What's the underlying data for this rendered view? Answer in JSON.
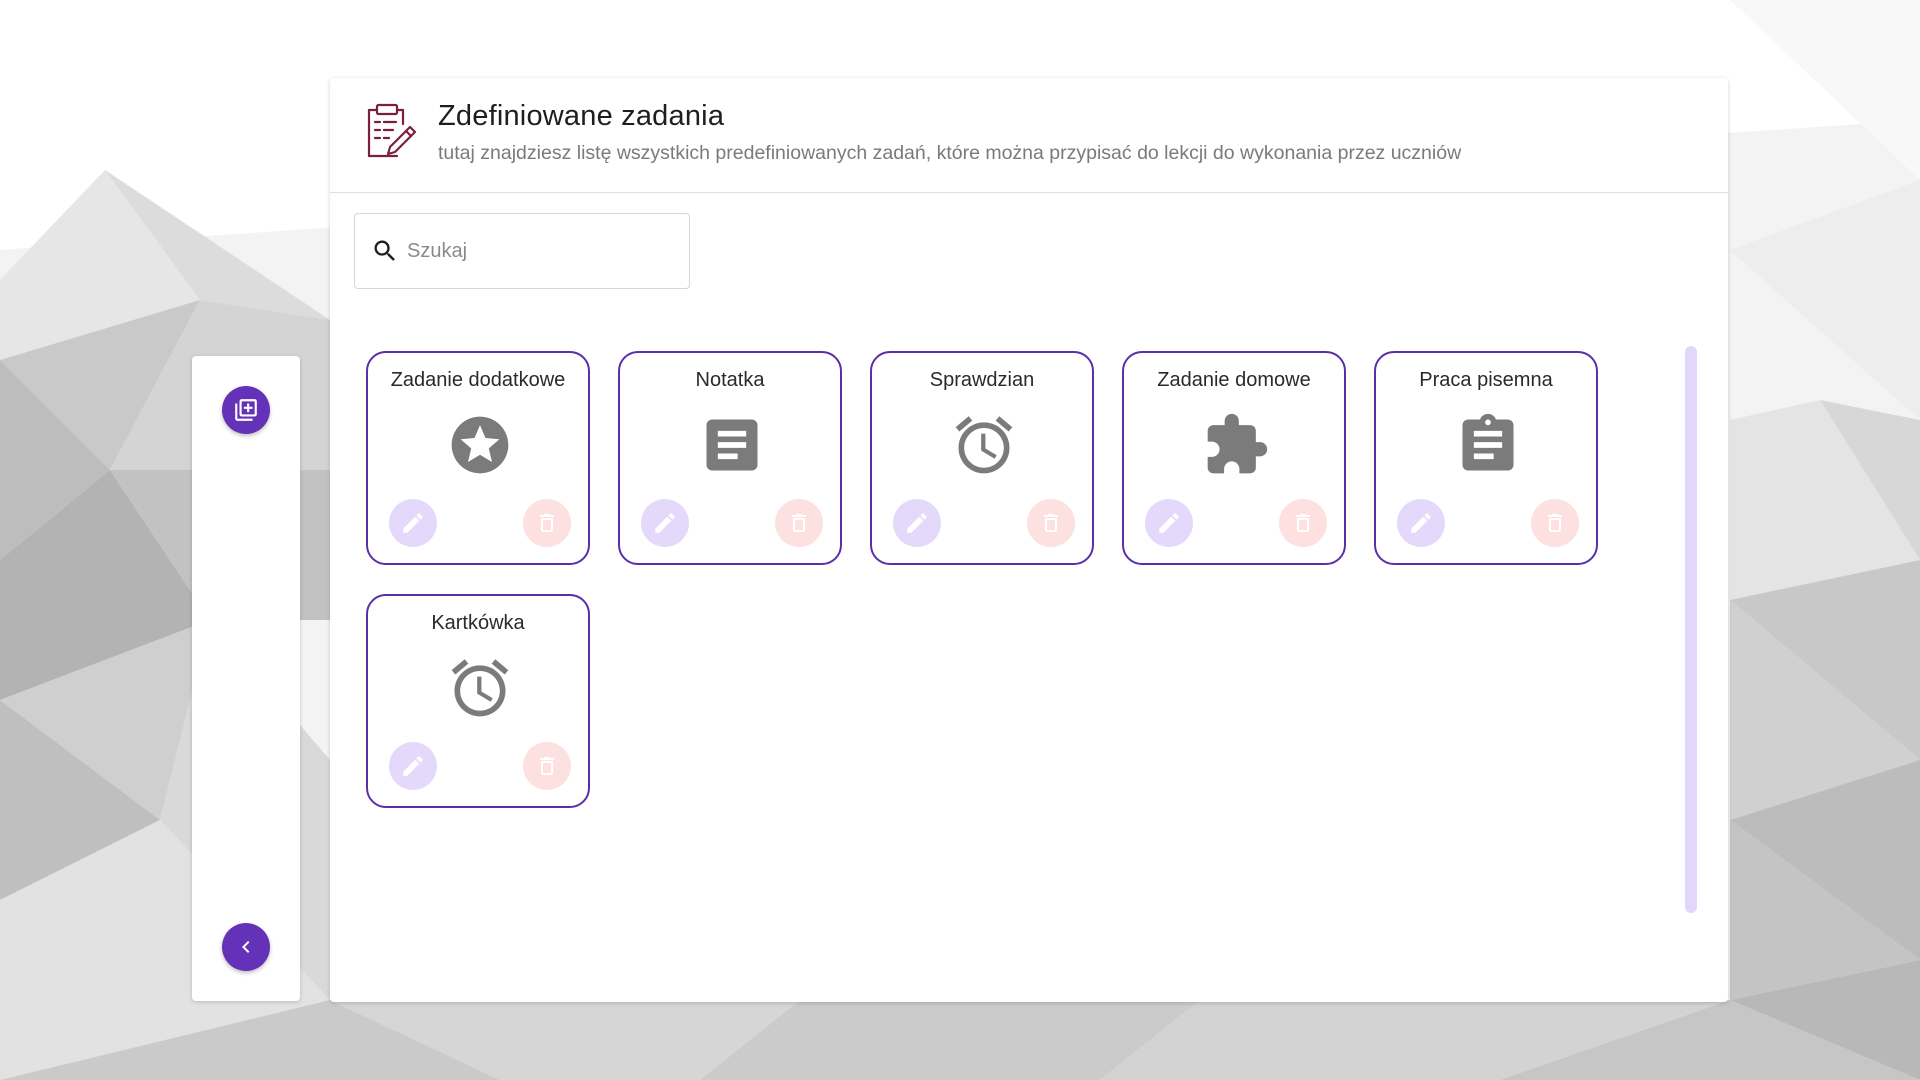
{
  "header": {
    "title": "Zdefiniowane zadania",
    "subtitle": "tutaj znajdziesz listę wszystkich predefiniowanych zadań, które można przypisać do lekcji do wykonania przez uczniów",
    "icon": "clipboard-pen-icon"
  },
  "search": {
    "placeholder": "Szukaj",
    "value": "",
    "icon": "search-icon"
  },
  "rail": {
    "add_icon": "add-library-icon",
    "collapse_icon": "chevron-left-icon"
  },
  "tasks": [
    {
      "name": "Zadanie dodatkowe",
      "icon": "star-circle-icon"
    },
    {
      "name": "Notatka",
      "icon": "note-icon"
    },
    {
      "name": "Sprawdzian",
      "icon": "alarm-clock-icon"
    },
    {
      "name": "Zadanie domowe",
      "icon": "puzzle-icon"
    },
    {
      "name": "Praca pisemna",
      "icon": "clipboard-text-icon"
    },
    {
      "name": "Kartkówka",
      "icon": "alarm-clock-icon"
    }
  ],
  "card_actions": {
    "edit_icon": "pencil-icon",
    "delete_icon": "trash-icon"
  },
  "colors": {
    "accent": "#6432b8",
    "card_border": "#5b2fa8",
    "edit_bg": "#e4d9fb",
    "delete_bg": "#fde0e0",
    "icon_gray": "#7b7b7b"
  }
}
